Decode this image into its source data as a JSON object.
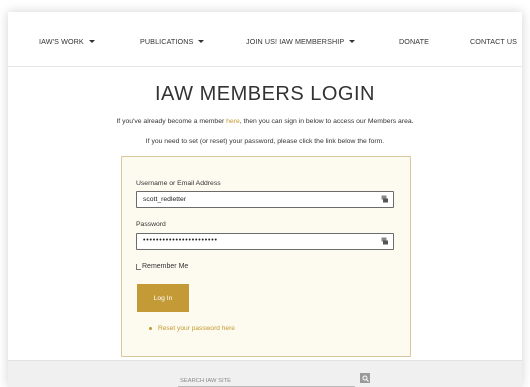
{
  "nav": {
    "items": [
      {
        "label": "IAW'S WORK",
        "dropdown": true
      },
      {
        "label": "PUBLICATIONS",
        "dropdown": true
      },
      {
        "label": "JOIN US! IAW MEMBERSHIP",
        "dropdown": true
      },
      {
        "label": "DONATE",
        "dropdown": false
      },
      {
        "label": "CONTACT US",
        "dropdown": false
      }
    ]
  },
  "page": {
    "title": "IAW MEMBERS LOGIN",
    "intro_before": "If you've already become a member ",
    "intro_link": "here",
    "intro_after": ", then you can sign in below to access our Members area.",
    "intro2": "If you need to set (or reset) your password, please click the link below the form."
  },
  "form": {
    "username_label": "Username or Email Address",
    "username_value": "scott_redletter",
    "password_label": "Password",
    "password_masked": "•••••••••••••••••••••••",
    "remember_label": "Remember Me",
    "login_label": "Log In",
    "reset_label": "Reset your password here"
  },
  "footer": {
    "search_placeholder": "SEARCH IAW SITE"
  },
  "colors": {
    "accent": "#c39a35",
    "form_bg": "#fdfaf0",
    "form_border": "#d8c79a"
  }
}
